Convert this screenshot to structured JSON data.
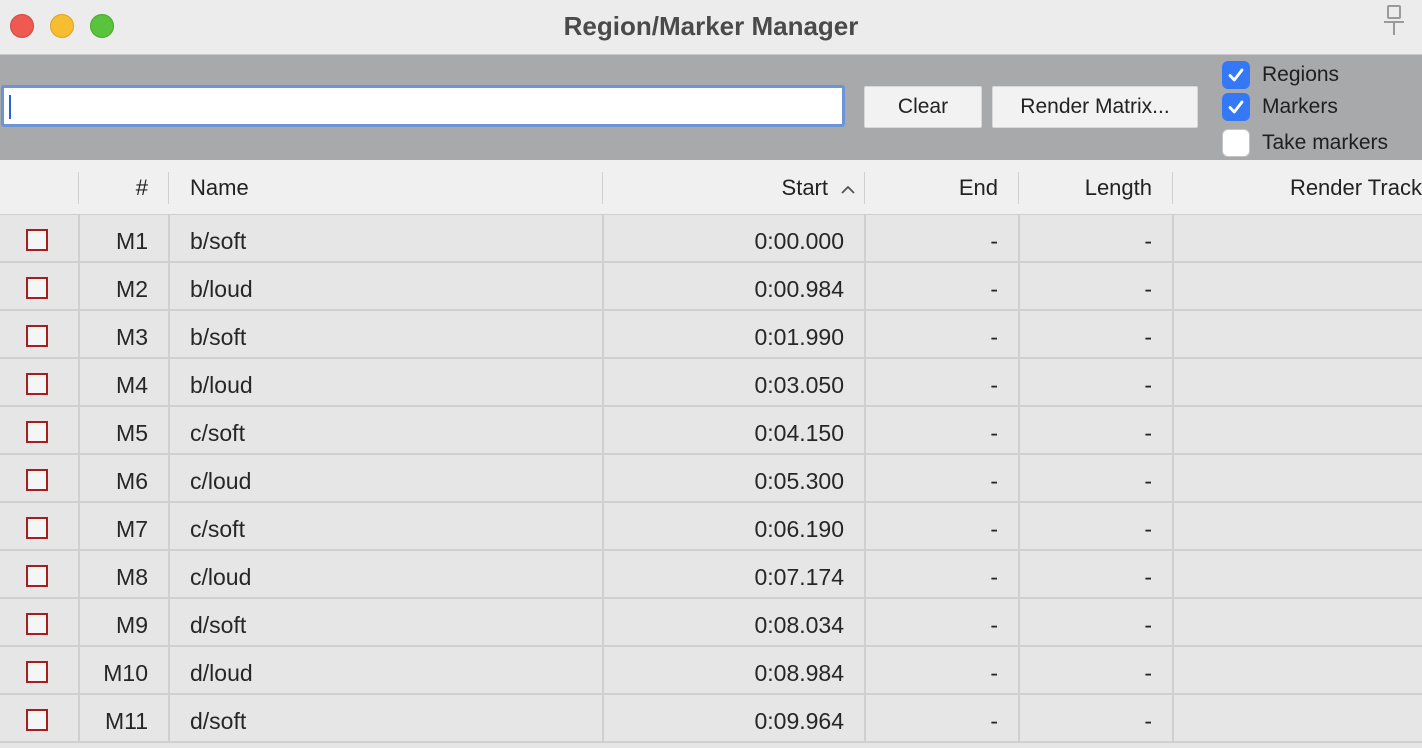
{
  "window": {
    "title": "Region/Marker Manager"
  },
  "toolbar": {
    "search_value": "",
    "clear_label": "Clear",
    "render_matrix_label": "Render Matrix...",
    "filters": [
      {
        "label": "Regions",
        "checked": true
      },
      {
        "label": "Markers",
        "checked": true
      },
      {
        "label": "Take markers",
        "checked": false
      }
    ]
  },
  "table": {
    "columns": {
      "select": "",
      "number": "#",
      "name": "Name",
      "start": "Start",
      "end": "End",
      "length": "Length",
      "render_track": "Render Track"
    },
    "sort": {
      "column": "Start",
      "direction": "ascending",
      "icon": "chevron-up-icon"
    },
    "rows": [
      {
        "number": "M1",
        "name": "b/soft",
        "start": "0:00.000",
        "end": "-",
        "length": "-",
        "render_track": ""
      },
      {
        "number": "M2",
        "name": "b/loud",
        "start": "0:00.984",
        "end": "-",
        "length": "-",
        "render_track": ""
      },
      {
        "number": "M3",
        "name": "b/soft",
        "start": "0:01.990",
        "end": "-",
        "length": "-",
        "render_track": ""
      },
      {
        "number": "M4",
        "name": "b/loud",
        "start": "0:03.050",
        "end": "-",
        "length": "-",
        "render_track": ""
      },
      {
        "number": "M5",
        "name": "c/soft",
        "start": "0:04.150",
        "end": "-",
        "length": "-",
        "render_track": ""
      },
      {
        "number": "M6",
        "name": "c/loud",
        "start": "0:05.300",
        "end": "-",
        "length": "-",
        "render_track": ""
      },
      {
        "number": "M7",
        "name": "c/soft",
        "start": "0:06.190",
        "end": "-",
        "length": "-",
        "render_track": ""
      },
      {
        "number": "M8",
        "name": "c/loud",
        "start": "0:07.174",
        "end": "-",
        "length": "-",
        "render_track": ""
      },
      {
        "number": "M9",
        "name": "d/soft",
        "start": "0:08.034",
        "end": "-",
        "length": "-",
        "render_track": ""
      },
      {
        "number": "M10",
        "name": "d/loud",
        "start": "0:08.984",
        "end": "-",
        "length": "-",
        "render_track": ""
      },
      {
        "number": "M11",
        "name": "d/soft",
        "start": "0:09.964",
        "end": "-",
        "length": "-",
        "render_track": ""
      }
    ]
  },
  "colors": {
    "checkbox_accent": "#3478f6",
    "row_checkbox_border": "#a32020",
    "toolbar_bg": "#a8a9aa",
    "search_focus": "#6b95d6"
  }
}
